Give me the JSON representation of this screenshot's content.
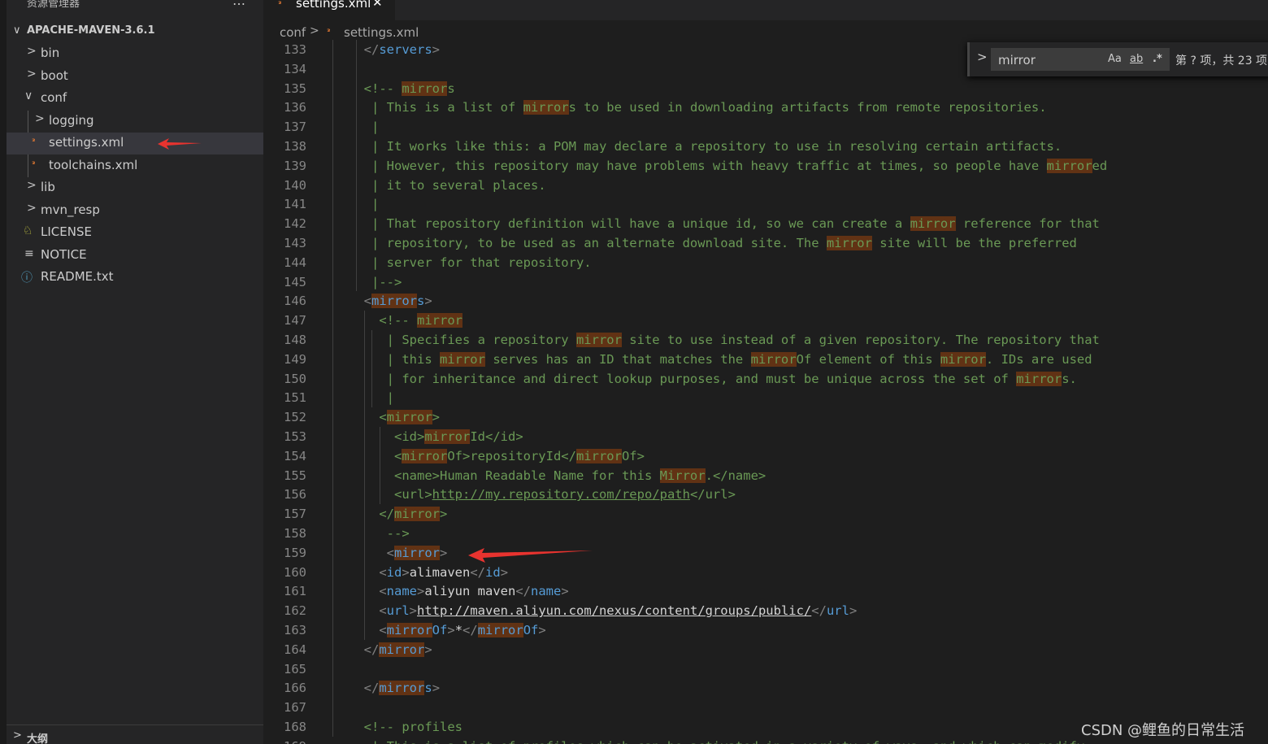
{
  "sidebar": {
    "title": "资源管理器",
    "more_icon": "…",
    "root_label": "APACHE-MAVEN-3.6.1",
    "outline_label": "大纲"
  },
  "tree": [
    {
      "label": "bin",
      "kind": "folder",
      "expanded": false
    },
    {
      "label": "boot",
      "kind": "folder",
      "expanded": false
    },
    {
      "label": "conf",
      "kind": "folder",
      "expanded": true
    },
    {
      "label": "logging",
      "kind": "folder",
      "expanded": false
    },
    {
      "label": "settings.xml",
      "kind": "rss-file",
      "selected": true
    },
    {
      "label": "toolchains.xml",
      "kind": "rss-file"
    },
    {
      "label": "lib",
      "kind": "folder",
      "expanded": false
    },
    {
      "label": "mvn_resp",
      "kind": "folder",
      "expanded": false
    },
    {
      "label": "LICENSE",
      "kind": "license-file"
    },
    {
      "label": "NOTICE",
      "kind": "text-file"
    },
    {
      "label": "README.txt",
      "kind": "info-file"
    }
  ],
  "tab": {
    "label": "settings.xml",
    "close": "✕"
  },
  "breadcrumb": {
    "folder": "conf",
    "separator": ">",
    "file": "settings.xml"
  },
  "find": {
    "value": "mirror",
    "match_case": "Aa",
    "whole_word": "ab",
    "regex": ".*",
    "result": "第 ? 项，共 23 项"
  },
  "code_lines": [
    {
      "n": "133",
      "html": "  <span class=\"p\">&lt;/</span><span class=\"t\">servers</span><span class=\"p\">&gt;</span>"
    },
    {
      "n": "134",
      "html": ""
    },
    {
      "n": "135",
      "html": "  &lt;!-- <span class=\"hl\">mirror</span>s"
    },
    {
      "n": "136",
      "html": "   | This is a list of <span class=\"hl\">mirror</span>s to be used in downloading artifacts from remote repositories."
    },
    {
      "n": "137",
      "html": "   |"
    },
    {
      "n": "138",
      "html": "   | It works like this: a POM may declare a repository to use in resolving certain artifacts."
    },
    {
      "n": "139",
      "html": "   | However, this repository may have problems with heavy traffic at times, so people have <span class=\"hl\">mirror</span>ed"
    },
    {
      "n": "140",
      "html": "   | it to several places."
    },
    {
      "n": "141",
      "html": "   |"
    },
    {
      "n": "142",
      "html": "   | That repository definition will have a unique id, so we can create a <span class=\"hl\">mirror</span> reference for that"
    },
    {
      "n": "143",
      "html": "   | repository, to be used as an alternate download site. The <span class=\"hl\">mirror</span> site will be the preferred"
    },
    {
      "n": "144",
      "html": "   | server for that repository."
    },
    {
      "n": "145",
      "html": "   |--&gt;"
    },
    {
      "n": "146",
      "html": "  <span class=\"p\">&lt;</span><span class=\"t\"><span class=\"hl\">mirror</span>s</span><span class=\"p\">&gt;</span>"
    },
    {
      "n": "147",
      "html": "    &lt;!-- <span class=\"hl\">mirror</span>"
    },
    {
      "n": "148",
      "html": "     | Specifies a repository <span class=\"hl\">mirror</span> site to use instead of a given repository. The repository that"
    },
    {
      "n": "149",
      "html": "     | this <span class=\"hl\">mirror</span> serves has an ID that matches the <span class=\"hl\">mirror</span>Of element of this <span class=\"hl\">mirror</span>. IDs are used"
    },
    {
      "n": "150",
      "html": "     | for inheritance and direct lookup purposes, and must be unique across the set of <span class=\"hl\">mirror</span>s."
    },
    {
      "n": "151",
      "html": "     |"
    },
    {
      "n": "152",
      "html": "    &lt;<span class=\"hl\">mirror</span>&gt;"
    },
    {
      "n": "153",
      "html": "      &lt;id&gt;<span class=\"hl\">mirror</span>Id&lt;/id&gt;"
    },
    {
      "n": "154",
      "html": "      &lt;<span class=\"hl\">mirror</span>Of&gt;repositoryId&lt;/<span class=\"hl\">mirror</span>Of&gt;"
    },
    {
      "n": "155",
      "html": "      &lt;name&gt;Human Readable Name for this <span class=\"hl\">Mirror</span>.&lt;/name&gt;"
    },
    {
      "n": "156",
      "html": "      &lt;url&gt;<span class=\"u\">http://my.repository.com/repo/path</span>&lt;/url&gt;"
    },
    {
      "n": "157",
      "html": "    &lt;/<span class=\"hl\">mirror</span>&gt;"
    },
    {
      "n": "158",
      "html": "     --&gt;"
    },
    {
      "n": "159",
      "html": "     <span class=\"p\">&lt;</span><span class=\"t\"><span class=\"hl\">mirror</span></span><span class=\"p\">&gt;</span>"
    },
    {
      "n": "160",
      "html": "    <span class=\"p\">&lt;</span><span class=\"t\">id</span><span class=\"p\">&gt;</span><span class=\"w\">alimaven</span><span class=\"p\">&lt;/</span><span class=\"t\">id</span><span class=\"p\">&gt;</span>"
    },
    {
      "n": "161",
      "html": "    <span class=\"p\">&lt;</span><span class=\"t\">name</span><span class=\"p\">&gt;</span><span class=\"w\">aliyun maven</span><span class=\"p\">&lt;/</span><span class=\"t\">name</span><span class=\"p\">&gt;</span>"
    },
    {
      "n": "162",
      "html": "    <span class=\"p\">&lt;</span><span class=\"t\">url</span><span class=\"p\">&gt;</span><span class=\"w u\">http://maven.aliyun.com/nexus/content/groups/public/</span><span class=\"p\">&lt;/</span><span class=\"t\">url</span><span class=\"p\">&gt;</span>"
    },
    {
      "n": "163",
      "html": "    <span class=\"p\">&lt;</span><span class=\"t\"><span class=\"hl\">mirror</span>Of</span><span class=\"p\">&gt;</span><span class=\"w\">*</span><span class=\"p\">&lt;/</span><span class=\"t\"><span class=\"hl\">mirror</span>Of</span><span class=\"p\">&gt;</span>"
    },
    {
      "n": "164",
      "html": "  <span class=\"p\">&lt;/</span><span class=\"t\"><span class=\"hl\">mirror</span></span><span class=\"p\">&gt;</span>"
    },
    {
      "n": "165",
      "html": ""
    },
    {
      "n": "166",
      "html": "  <span class=\"p\">&lt;/</span><span class=\"t\"><span class=\"hl\">mirror</span>s</span><span class=\"p\">&gt;</span>"
    },
    {
      "n": "167",
      "html": ""
    },
    {
      "n": "168",
      "html": "  &lt;!-- profiles"
    },
    {
      "n": "169",
      "html": "   | This is a list of profiles which can be activated in a variety of ways, and which can modify"
    }
  ],
  "watermark": "CSDN @鲤鱼的日常生活",
  "colors": {
    "highlight": "#613214",
    "comment": "#6a9955",
    "tag": "#569cd6",
    "arrow": "#e8332f"
  }
}
